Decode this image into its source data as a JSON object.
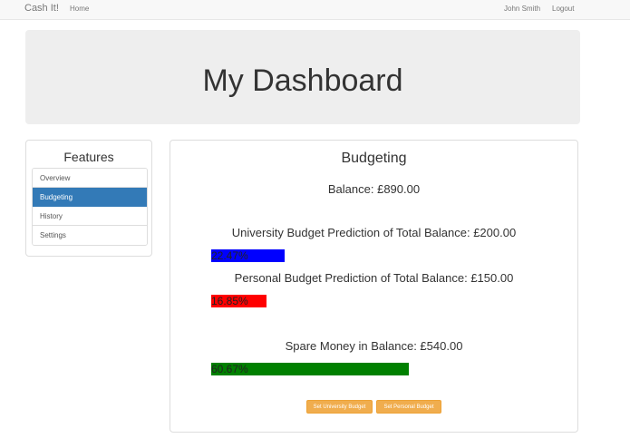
{
  "navbar": {
    "brand": "Cash It!",
    "home": "Home",
    "user": "John Smith",
    "logout": "Logout"
  },
  "header": {
    "title": "My Dashboard"
  },
  "features": {
    "title": "Features",
    "items": [
      {
        "label": "Overview"
      },
      {
        "label": "Budgeting"
      },
      {
        "label": "History"
      },
      {
        "label": "Settings"
      }
    ],
    "active_index": 1
  },
  "budgeting": {
    "title": "Budgeting",
    "balance": "Balance: £890.00",
    "university": {
      "text": "University Budget Prediction of Total Balance: £200.00",
      "percent_label": "22.47%",
      "percent": 22.47,
      "color": "#0000ff"
    },
    "personal": {
      "text": "Personal Budget Prediction of Total Balance: £150.00",
      "percent_label": "16.85%",
      "percent": 16.85,
      "color": "#ff0000"
    },
    "spare": {
      "text": "Spare Money in Balance: £540.00",
      "percent_label": "60.67%",
      "percent": 60.67,
      "color": "#008000"
    },
    "buttons": {
      "set_university": "Set University Budget",
      "set_personal": "Set Personal Budget"
    }
  },
  "colors": {
    "accent": "#337ab7",
    "warning": "#f0ad4e"
  }
}
